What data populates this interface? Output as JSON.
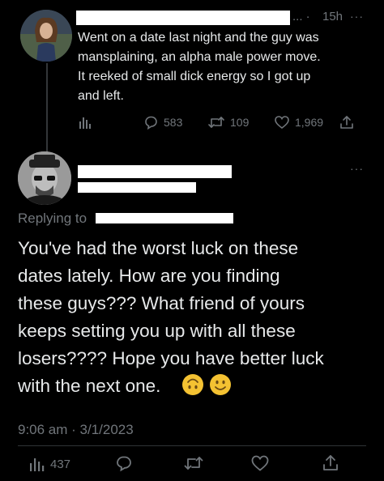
{
  "tweet1": {
    "time": "15h",
    "separator": "... ·",
    "more": "···",
    "text_lines": [
      "Went on a date last night and the guy was",
      "mansplaining, an alpha male power move.",
      "It reeked of small dick energy so I got up",
      "and left."
    ],
    "stats": {
      "replies": "583",
      "retweets": "109",
      "likes": "1,969"
    }
  },
  "tweet2": {
    "more": "···",
    "replying_to": "Replying to",
    "text_lines": [
      "You've had the worst luck on these",
      "dates lately.  How are you finding",
      "these guys???  What friend of yours",
      "keeps setting you up with all these",
      "losers????  Hope you have better luck",
      "with the next one."
    ],
    "emojis": [
      "upside-down-face",
      "slightly-smiling-face"
    ],
    "timestamp": "9:06 am · 3/1/2023",
    "views": "437"
  },
  "colors": {
    "background": "#000000",
    "text": "#e7e9ea",
    "muted": "#71767b",
    "link": "#1d9bf0",
    "emoji_yellow": "#f4c232"
  }
}
